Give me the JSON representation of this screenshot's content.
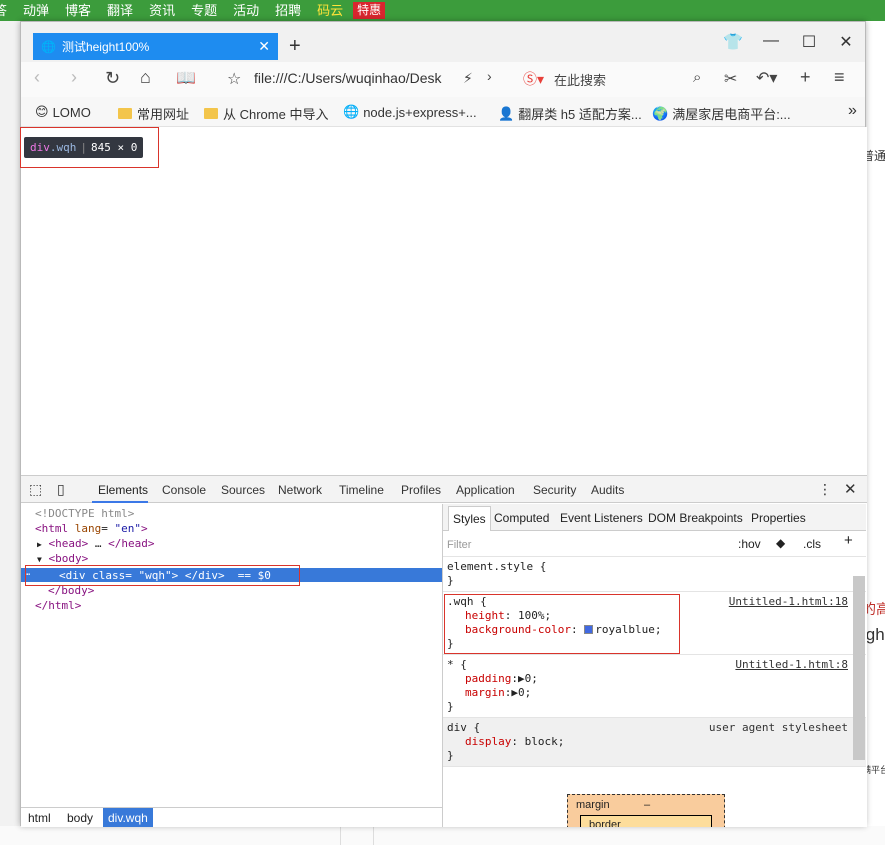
{
  "site_nav": {
    "items": [
      "答",
      "动弹",
      "博客",
      "翻译",
      "资讯",
      "专题",
      "活动",
      "招聘",
      "码云"
    ],
    "badge": "特惠"
  },
  "background_right": {
    "frag1": "普通",
    "frag2": "的高",
    "frag3": "igh",
    "frag4": "满平台"
  },
  "browser": {
    "tab_title": "测试height100%",
    "address": "file:///C:/Users/wuqinhao/Desk",
    "search_placeholder": "在此搜索",
    "bookmarks": [
      {
        "label": "LOMO",
        "icon": "lomo-icon"
      },
      {
        "label": "常用网址",
        "icon": "folder-icon"
      },
      {
        "label": "从 Chrome 中导入",
        "icon": "folder-icon"
      },
      {
        "label": "node.js+express+...",
        "icon": "globe-icon"
      },
      {
        "label": "翻屏类 h5 适配方案...",
        "icon": "person-icon"
      },
      {
        "label": "满屋家居电商平台:...",
        "icon": "ie-icon"
      }
    ],
    "more_bookmarks": "»"
  },
  "inspect_tooltip": {
    "tag": "div",
    "cls": ".wqh",
    "size": "845 × 0"
  },
  "devtools": {
    "tabs": [
      "Elements",
      "Console",
      "Sources",
      "Network",
      "Timeline",
      "Profiles",
      "Application",
      "Security",
      "Audits"
    ],
    "dom": {
      "doctype": "<!DOCTYPE html>",
      "html_open_tag": "<html",
      "html_attr": "lang",
      "html_attr_val": "\"en\"",
      "head_open": "<head>",
      "head_ellipsis": "…",
      "head_close": "</head>",
      "body_open": "<body>",
      "selected": "<div class= \"wqh\"> </div>  == $0",
      "body_close": "</body>",
      "html_close": "</html>"
    },
    "breadcrumbs": [
      "html",
      "body",
      "div.wqh"
    ],
    "styles_tabs": [
      "Styles",
      "Computed",
      "Event Listeners",
      "DOM Breakpoints",
      "Properties"
    ],
    "filter_placeholder": "Filter",
    "hov": ":hov",
    "cls": ".cls",
    "rules": {
      "element_style": "element.style {",
      "close": "}",
      "wqh_selector": ".wqh {",
      "wqh_src": "Untitled-1.html:18",
      "wqh_height_name": "height",
      "wqh_height_val": "100%;",
      "wqh_bg_name": "background-color",
      "wqh_bg_val": "royalblue;",
      "star_selector": "* {",
      "star_src": "Untitled-1.html:8",
      "star_padding": "padding",
      "star_padding_val": "0;",
      "star_margin": "margin",
      "star_margin_val": "0;",
      "div_selector": "div {",
      "div_src": "user agent stylesheet",
      "div_display": "display",
      "div_display_val": "block;"
    },
    "boxmodel": {
      "margin": "margin",
      "dash": "–",
      "border": "border"
    }
  },
  "colors": {
    "accent": "#1e8cf0",
    "swatch": "#4169e1",
    "nav": "#3c9c3c"
  }
}
